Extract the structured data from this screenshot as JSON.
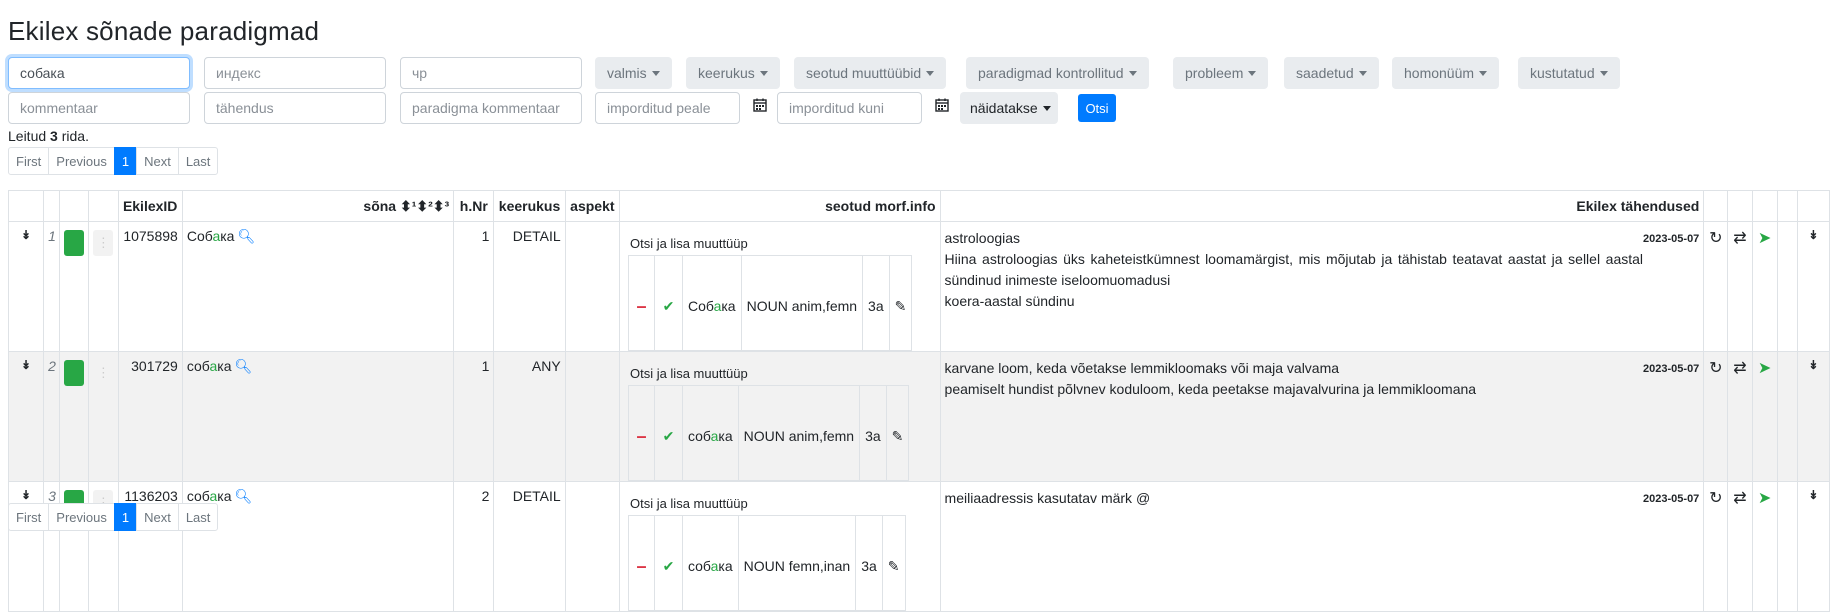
{
  "page": {
    "title": "Ekilex sõnade paradigmad"
  },
  "filters": {
    "sona_value": "собака",
    "index_placeholder": "индекс",
    "chr_placeholder": "чр",
    "dropdowns": [
      "valmis",
      "keerukus",
      "seotud muuttüübid",
      "paradigmad kontrollitud",
      "probleem",
      "saadetud",
      "homonüüm",
      "kustutatud"
    ],
    "kommentaar_placeholder": "kommentaar",
    "tahendus_placeholder": "tähendus",
    "paradigma_kommentaar_placeholder": "paradigma kommentaar",
    "imporditud_peale_placeholder": "imporditud peale",
    "imporditud_kuni_placeholder": "imporditud kuni",
    "naidatakse_label": "näidatakse",
    "otsi_label": "Otsi"
  },
  "results": {
    "prefix": "Leitud ",
    "count": "3",
    "suffix": " rida."
  },
  "pager": {
    "first": "First",
    "previous": "Previous",
    "current": "1",
    "next": "Next",
    "last": "Last"
  },
  "table": {
    "headers": {
      "ekilex_id": "EkilexID",
      "sona": "sõna ⬍¹⬍²⬍³",
      "hnr": "h.Nr",
      "keerukus": "keerukus",
      "aspekt": "aspekt",
      "morf": "seotud morf.info",
      "tahendused": "Ekilex tähendused"
    },
    "rows": [
      {
        "idx": "1",
        "id": "1075898",
        "word_a": "Соб",
        "word_b": "а",
        "word_c": "ка",
        "hnr": "1",
        "keerukus": "DETAIL",
        "morf_title": "Otsi ja lisa muuttüüp",
        "morf_word_a": "Соб",
        "morf_word_b": "а",
        "morf_word_c": "ка",
        "morf_pos": "NOUN anim,femn",
        "morf_type": "3a",
        "date": "2023-05-07",
        "defs": [
          "astroloogias",
          "Hiina astroloogias üks kaheteistkümnest loomamärgist, mis mõjutab ja tähistab teatavat aastat ja sellel aastal sündinud inimeste iseloomuomadusi",
          "koera-aastal sündinu"
        ]
      },
      {
        "idx": "2",
        "id": "301729",
        "word_a": "соб",
        "word_b": "а",
        "word_c": "ка",
        "hnr": "1",
        "keerukus": "ANY",
        "morf_title": "Otsi ja lisa muuttüüp",
        "morf_word_a": "соб",
        "morf_word_b": "а",
        "morf_word_c": "ка",
        "morf_pos": "NOUN anim,femn",
        "morf_type": "3a",
        "date": "2023-05-07",
        "defs": [
          "karvane loom, keda võetakse lemmikloomaks või maja valvama",
          "peamiselt hundist põlvnev koduloom, keda peetakse majavalvurina ja lemmikloomana"
        ]
      },
      {
        "idx": "3",
        "id": "1136203",
        "word_a": "соб",
        "word_b": "а",
        "word_c": "ка",
        "hnr": "2",
        "keerukus": "DETAIL",
        "morf_title": "Otsi ja lisa muuttüüp",
        "morf_word_a": "соб",
        "morf_word_b": "а",
        "morf_word_c": "ка",
        "morf_pos": "NOUN femn,inan",
        "morf_type": "3a",
        "date": "2023-05-07",
        "defs": [
          "meiliaadressis kasutatav märk @"
        ]
      }
    ]
  }
}
